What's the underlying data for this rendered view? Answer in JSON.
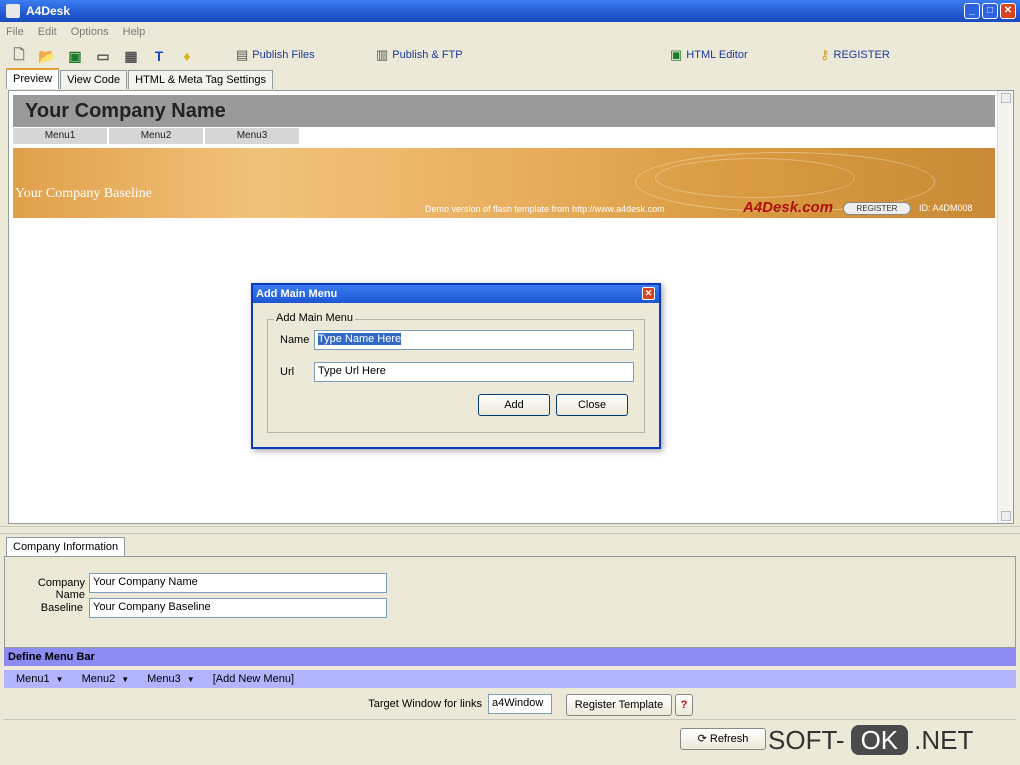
{
  "window": {
    "title": "A4Desk"
  },
  "menus": [
    "File",
    "Edit",
    "Options",
    "Help"
  ],
  "toolbar": {
    "icons": [
      "new-icon",
      "open-icon",
      "save-icon",
      "preview-icon",
      "template-icon",
      "text-icon",
      "tip-icon"
    ],
    "publish_files": "Publish Files",
    "publish_ftp": "Publish & FTP",
    "html_editor": "HTML Editor",
    "register": "REGISTER"
  },
  "top_tabs": [
    "Preview",
    "View Code",
    "HTML & Meta Tag Settings"
  ],
  "preview": {
    "company_name": "Your Company Name",
    "menu_items": [
      "Menu1",
      "Menu2",
      "Menu3"
    ],
    "baseline": "Your Company Baseline",
    "demo_text": "Demo version of flash template from http://www.a4desk.com",
    "brand": "A4Desk.com",
    "register_pill": "REGISTER",
    "code": "ID: A4DM008"
  },
  "dialog": {
    "title": "Add Main Menu",
    "group_label": "Add Main Menu",
    "name_label": "Name",
    "name_value": "Type Name Here",
    "url_label": "Url",
    "url_value": "Type Url Here",
    "add_label": "Add",
    "close_label": "Close"
  },
  "company_info": {
    "tab_label": "Company Information",
    "company_name_label": "Company Name",
    "company_name_value": "Your Company Name",
    "baseline_label": "Baseline",
    "baseline_value": "Your Company Baseline"
  },
  "define_menu": {
    "title": "Define Menu Bar",
    "items": [
      "Menu1",
      "Menu2",
      "Menu3"
    ],
    "add_new": "[Add New Menu]"
  },
  "target": {
    "label": "Target Window for links",
    "value": "a4Window",
    "register_template": "Register Template",
    "help": "?"
  },
  "status": {
    "refresh": "Refresh"
  },
  "watermark": {
    "left": "SOFT-",
    "middle": "OK",
    "right": ".NET"
  }
}
